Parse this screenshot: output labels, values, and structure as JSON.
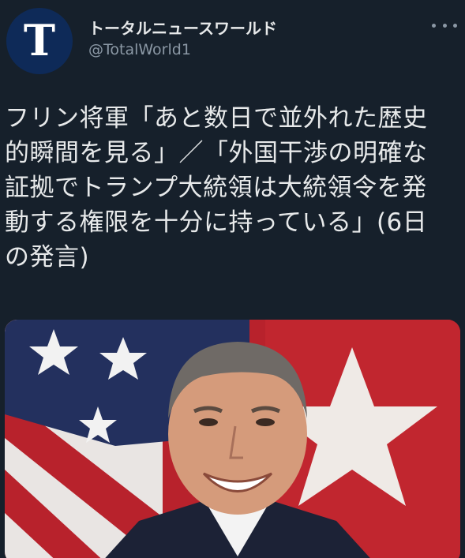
{
  "tweet": {
    "author": {
      "display_name": "トータルニュースワールド",
      "handle": "@TotalWorld1",
      "avatar_letter": "T",
      "avatar_color": "#0e2a58"
    },
    "more_icon": "more-horizontal-icon",
    "text": "フリン将軍「あと数日で並外れた歴史\n的瞬間を見る」／「外国干渉の明確な\n証拠でトランプ大統領は大統領令を発\n動する権限を十分に持っている」(6日\nの発言)",
    "media": {
      "subject": "photo-of-general-in-uniform-with-flags",
      "colors": {
        "flag_red": "#c1262f",
        "flag_blue": "#23305e",
        "suit": "#1c2236"
      }
    }
  },
  "theme": {
    "background": "#16202b",
    "text_primary": "#e7e9ea",
    "text_secondary": "#8b98a5"
  }
}
